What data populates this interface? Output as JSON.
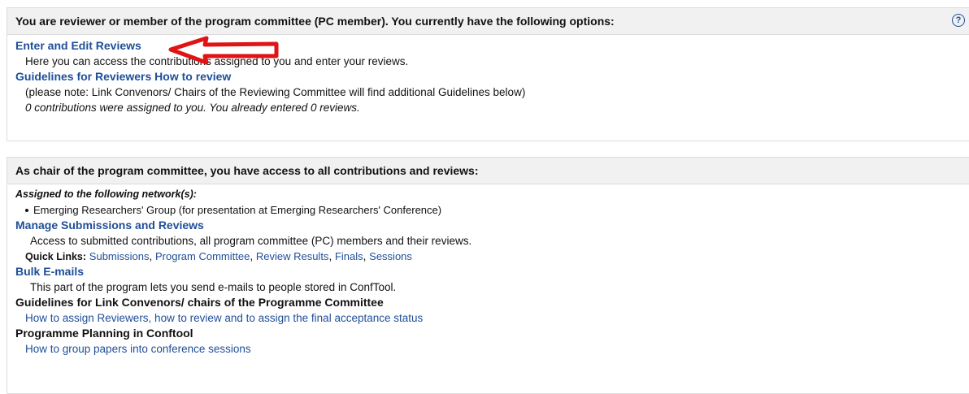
{
  "panel1": {
    "heading": "You are reviewer or member of the program committee (PC member). You currently have the following options:",
    "help_icon": "question-circle-icon",
    "enter_reviews": {
      "title": "Enter and Edit Reviews",
      "desc": "Here you can access the contributions assigned to you and enter your reviews."
    },
    "guidelines": {
      "title": "Guidelines for Reviewers How to review",
      "desc": "(please note: Link Convenors/ Chairs of the Reviewing Committee will find additional Guidelines below)"
    },
    "status": "0 contributions were assigned to you. You already entered 0 reviews."
  },
  "annotation": {
    "arrow_color": "#e01414",
    "icon": "red-arrow-left-icon"
  },
  "panel2": {
    "heading": "As chair of the program committee, you have access to all contributions and reviews:",
    "assigned_label": "Assigned to the following network(s):",
    "networks": [
      "Emerging Researchers' Group (for presentation at Emerging Researchers' Conference)"
    ],
    "manage": {
      "title": "Manage Submissions and Reviews",
      "desc": "Access to submitted contributions, all program committee (PC) members and their reviews."
    },
    "quick_links": {
      "label": "Quick Links:",
      "items": [
        "Submissions",
        "Program Committee",
        "Review Results",
        "Finals",
        "Sessions"
      ],
      "separator": ", "
    },
    "bulk": {
      "title": "Bulk E-mails",
      "desc": "This part of the program lets you send e-mails to people stored in ConfTool."
    },
    "guidelines_convenors": {
      "title": "Guidelines for Link Convenors/ chairs of the Programme Committee",
      "link": "How to assign Reviewers, how to review and to assign the final acceptance status"
    },
    "planning": {
      "title": "Programme Planning in Conftool",
      "link": "How to group papers into conference sessions"
    }
  },
  "colors": {
    "link": "#1f4e99",
    "header_bg": "#f1f1f1",
    "border": "#dcdcdc"
  }
}
